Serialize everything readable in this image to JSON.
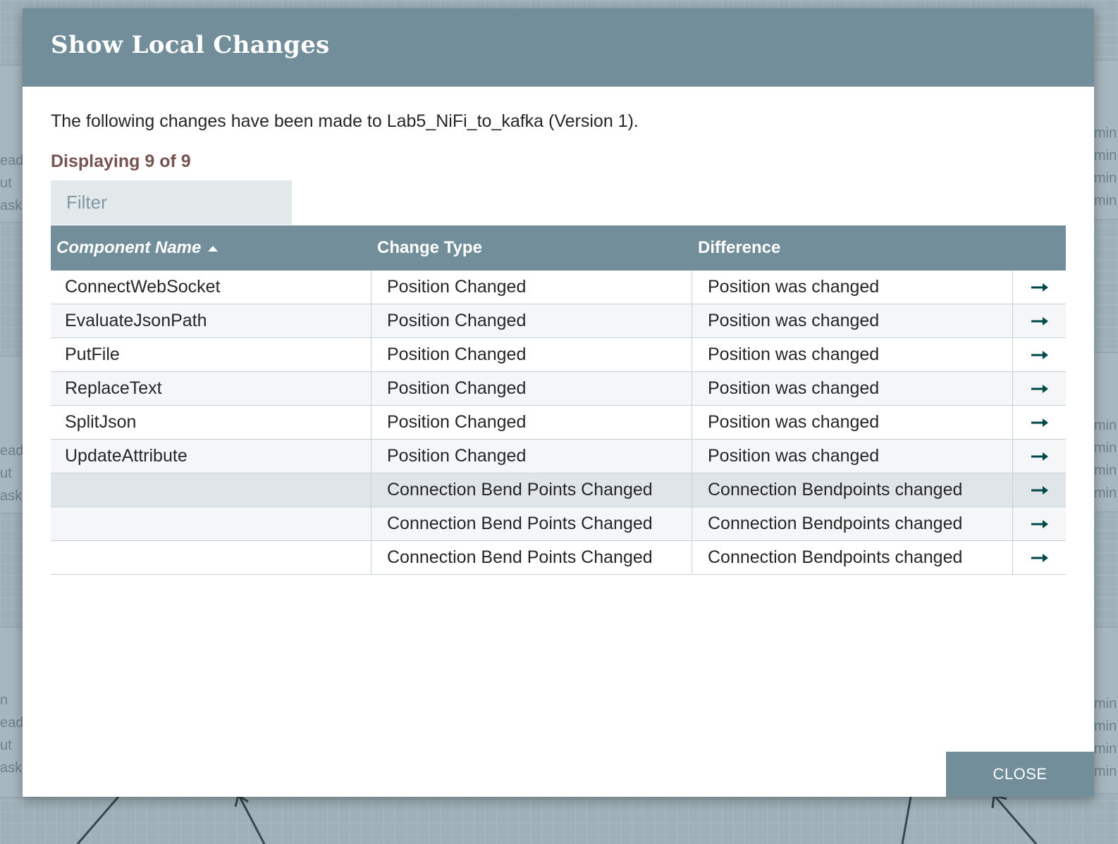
{
  "dialog": {
    "title": "Show Local Changes",
    "intro": "The following changes have been made to Lab5_NiFi_to_kafka (Version 1).",
    "displaying": "Displaying 9 of 9",
    "filter_placeholder": "Filter",
    "close_label": "CLOSE"
  },
  "table": {
    "columns": [
      "Component Name",
      "Change Type",
      "Difference"
    ],
    "sorted_column": "Component Name",
    "sort_direction": "ascending",
    "rows": [
      {
        "component": "ConnectWebSocket",
        "change_type": "Position Changed",
        "difference": "Position was changed"
      },
      {
        "component": "EvaluateJsonPath",
        "change_type": "Position Changed",
        "difference": "Position was changed"
      },
      {
        "component": "PutFile",
        "change_type": "Position Changed",
        "difference": "Position was changed"
      },
      {
        "component": "ReplaceText",
        "change_type": "Position Changed",
        "difference": "Position was changed"
      },
      {
        "component": "SplitJson",
        "change_type": "Position Changed",
        "difference": "Position was changed"
      },
      {
        "component": "UpdateAttribute",
        "change_type": "Position Changed",
        "difference": "Position was changed"
      },
      {
        "component": "",
        "change_type": "Connection Bend Points Changed",
        "difference": "Connection Bendpoints changed"
      },
      {
        "component": "",
        "change_type": "Connection Bend Points Changed",
        "difference": "Connection Bendpoints changed"
      },
      {
        "component": "",
        "change_type": "Connection Bend Points Changed",
        "difference": "Connection Bendpoints changed"
      }
    ],
    "row_icon": "go-to-arrow-icon",
    "highlighted_row": 7
  },
  "background": {
    "left_fragments": [
      "ead/",
      "ut",
      "asks"
    ],
    "left_fragments_2": [
      "ead/",
      "ut",
      "asks"
    ],
    "left_fragments_3": [
      "n",
      "ead",
      "ut",
      "asks"
    ],
    "right_fragments": [
      "min",
      "min",
      "min",
      "min"
    ]
  },
  "colors": {
    "header": "#728e9b",
    "displaying_text": "#775351",
    "arrow": "#004849",
    "canvas": "#9fb0b8"
  }
}
